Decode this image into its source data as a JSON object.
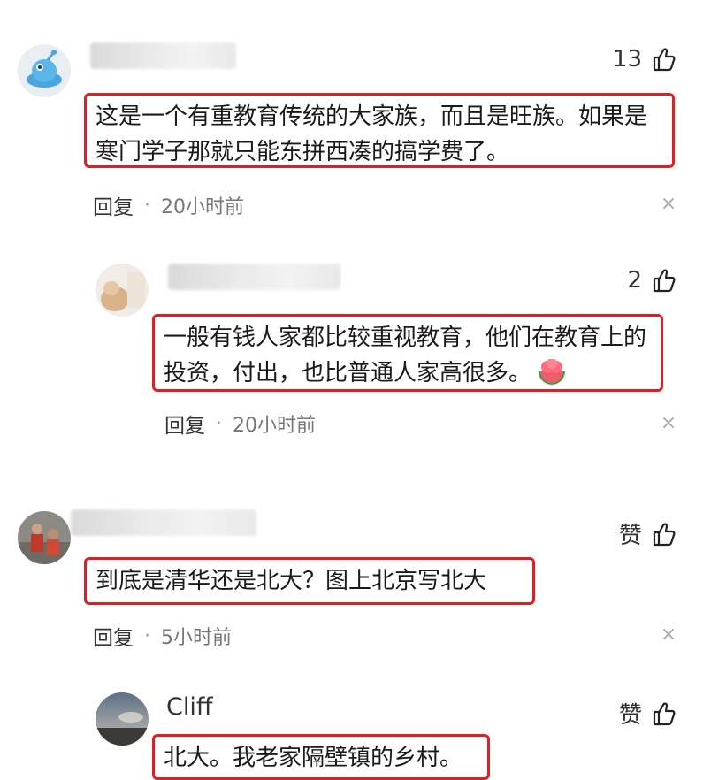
{
  "comments": [
    {
      "name": "",
      "likes": "13",
      "text": "这是一个有重教育传统的大家族，而且是旺族。如果是寒门学子那就只能东拼西凑的搞学费了。",
      "reply_label": "回复",
      "time": "20小时前",
      "close": "×",
      "avatar_icon": "blue-robot-avatar-icon"
    },
    {
      "name": "",
      "likes": "2",
      "text": "一般有钱人家都比较重视教育，他们在教育上的投资，付出，也比普通人家高很多。",
      "emoji": "watermelon-emoji-icon",
      "reply_label": "回复",
      "time": "20小时前",
      "close": "×",
      "avatar_icon": "photo-avatar-icon"
    },
    {
      "name": "",
      "likes": "赞",
      "text": "到底是清华还是北大？图上北京写北大",
      "reply_label": "回复",
      "time": "5小时前",
      "close": "×",
      "avatar_icon": "photo-avatar-icon"
    },
    {
      "name": "Cliff",
      "likes": "赞",
      "text": "北大。我老家隔壁镇的乡村。",
      "avatar_icon": "photo-avatar-icon"
    }
  ],
  "colors": {
    "highlight_border": "#e02020",
    "meta_text": "#777777"
  }
}
